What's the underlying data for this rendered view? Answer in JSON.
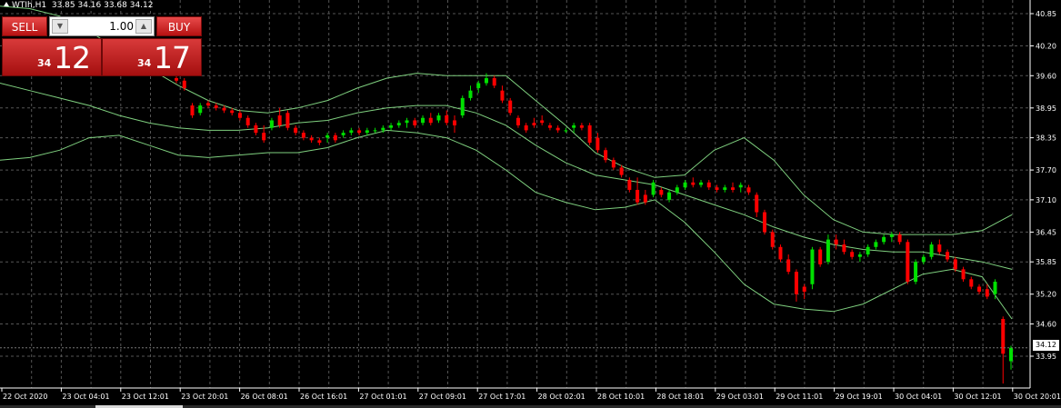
{
  "header": {
    "symbol": "WTIh,H1",
    "ohlc": "33.85 34.16 33.68 34.12"
  },
  "trade_panel": {
    "sell_label": "SELL",
    "buy_label": "BUY",
    "volume": "1.00",
    "sell_price_prefix": "34",
    "sell_price_big": "12",
    "buy_price_prefix": "34",
    "buy_price_big": "17"
  },
  "current_price_label": "34.12",
  "colors": {
    "background": "#000000",
    "grid": "#555555",
    "bull_candle": "#00e000",
    "bear_candle": "#ff0000",
    "bands": "#7fd07f",
    "axis_text": "#ffffff"
  },
  "chart_data": {
    "type": "candlestick",
    "title": "WTIh,H1",
    "price_axis_ticks": [
      "40.85",
      "40.20",
      "39.60",
      "38.95",
      "38.35",
      "37.70",
      "37.10",
      "36.45",
      "35.85",
      "35.20",
      "34.60",
      "33.95"
    ],
    "time_axis_ticks": [
      "22 Oct 2020",
      "23 Oct 04:01",
      "23 Oct 12:01",
      "23 Oct 20:01",
      "26 Oct 08:01",
      "26 Oct 16:01",
      "27 Oct 01:01",
      "27 Oct 09:01",
      "27 Oct 17:01",
      "28 Oct 02:01",
      "28 Oct 10:01",
      "28 Oct 18:01",
      "29 Oct 03:01",
      "29 Oct 11:01",
      "29 Oct 19:01",
      "30 Oct 04:01",
      "30 Oct 12:01",
      "30 Oct 20:01"
    ],
    "ylim": [
      33.45,
      41.0
    ],
    "last_close": 34.12,
    "grid": true,
    "candles": [
      [
        39.55,
        39.6,
        39.45,
        39.5
      ],
      [
        39.5,
        39.55,
        39.3,
        39.35
      ],
      [
        39.0,
        39.05,
        38.75,
        38.8
      ],
      [
        38.85,
        39.05,
        38.8,
        39.0
      ],
      [
        39.05,
        39.1,
        38.95,
        39.0
      ],
      [
        39.0,
        39.05,
        38.9,
        38.95
      ],
      [
        38.95,
        39.0,
        38.85,
        38.9
      ],
      [
        38.9,
        38.95,
        38.8,
        38.85
      ],
      [
        38.85,
        38.9,
        38.7,
        38.75
      ],
      [
        38.75,
        38.8,
        38.55,
        38.6
      ],
      [
        38.6,
        38.65,
        38.4,
        38.45
      ],
      [
        38.45,
        38.6,
        38.25,
        38.3
      ],
      [
        38.55,
        38.75,
        38.5,
        38.7
      ],
      [
        38.8,
        38.95,
        38.55,
        38.6
      ],
      [
        38.85,
        38.9,
        38.5,
        38.55
      ],
      [
        38.55,
        38.6,
        38.4,
        38.45
      ],
      [
        38.45,
        38.5,
        38.3,
        38.35
      ],
      [
        38.35,
        38.4,
        38.25,
        38.3
      ],
      [
        38.3,
        38.35,
        38.2,
        38.25
      ],
      [
        38.35,
        38.45,
        38.25,
        38.4
      ],
      [
        38.4,
        38.45,
        38.25,
        38.3
      ],
      [
        38.4,
        38.5,
        38.35,
        38.45
      ],
      [
        38.45,
        38.55,
        38.4,
        38.5
      ],
      [
        38.5,
        38.55,
        38.4,
        38.45
      ],
      [
        38.45,
        38.55,
        38.4,
        38.5
      ],
      [
        38.5,
        38.55,
        38.45,
        38.5
      ],
      [
        38.5,
        38.6,
        38.45,
        38.55
      ],
      [
        38.55,
        38.65,
        38.5,
        38.6
      ],
      [
        38.6,
        38.7,
        38.55,
        38.65
      ],
      [
        38.65,
        38.75,
        38.55,
        38.7
      ],
      [
        38.7,
        38.75,
        38.55,
        38.6
      ],
      [
        38.65,
        38.8,
        38.6,
        38.75
      ],
      [
        38.75,
        38.85,
        38.6,
        38.65
      ],
      [
        38.7,
        38.85,
        38.65,
        38.8
      ],
      [
        38.8,
        38.9,
        38.6,
        38.65
      ],
      [
        38.7,
        38.8,
        38.45,
        38.6
      ],
      [
        38.8,
        39.2,
        38.75,
        39.15
      ],
      [
        39.15,
        39.4,
        39.1,
        39.3
      ],
      [
        39.35,
        39.5,
        39.25,
        39.45
      ],
      [
        39.45,
        39.65,
        39.4,
        39.55
      ],
      [
        39.55,
        39.6,
        39.35,
        39.4
      ],
      [
        39.3,
        39.4,
        39.05,
        39.1
      ],
      [
        39.1,
        39.15,
        38.8,
        38.85
      ],
      [
        38.75,
        38.8,
        38.55,
        38.6
      ],
      [
        38.6,
        38.65,
        38.45,
        38.5
      ],
      [
        38.65,
        38.75,
        38.55,
        38.6
      ],
      [
        38.7,
        38.8,
        38.6,
        38.65
      ],
      [
        38.6,
        38.65,
        38.5,
        38.55
      ],
      [
        38.55,
        38.6,
        38.45,
        38.5
      ],
      [
        38.5,
        38.55,
        38.45,
        38.5
      ],
      [
        38.55,
        38.65,
        38.45,
        38.6
      ],
      [
        38.6,
        38.65,
        38.5,
        38.55
      ],
      [
        38.6,
        38.65,
        38.2,
        38.25
      ],
      [
        38.35,
        38.45,
        38.05,
        38.1
      ],
      [
        38.1,
        38.15,
        37.85,
        37.9
      ],
      [
        37.9,
        37.95,
        37.7,
        37.75
      ],
      [
        37.75,
        37.8,
        37.55,
        37.6
      ],
      [
        37.5,
        37.55,
        37.25,
        37.3
      ],
      [
        37.3,
        37.55,
        37.0,
        37.05
      ],
      [
        37.2,
        37.3,
        37.0,
        37.05
      ],
      [
        37.2,
        37.5,
        37.15,
        37.45
      ],
      [
        37.3,
        37.35,
        37.15,
        37.2
      ],
      [
        37.1,
        37.3,
        37.05,
        37.25
      ],
      [
        37.25,
        37.4,
        37.2,
        37.35
      ],
      [
        37.35,
        37.5,
        37.3,
        37.45
      ],
      [
        37.45,
        37.55,
        37.35,
        37.4
      ],
      [
        37.4,
        37.5,
        37.35,
        37.45
      ],
      [
        37.45,
        37.5,
        37.3,
        37.35
      ],
      [
        37.35,
        37.4,
        37.25,
        37.3
      ],
      [
        37.3,
        37.4,
        37.25,
        37.35
      ],
      [
        37.35,
        37.45,
        37.25,
        37.3
      ],
      [
        37.35,
        37.45,
        37.25,
        37.4
      ],
      [
        37.35,
        37.4,
        37.2,
        37.25
      ],
      [
        37.2,
        37.25,
        36.75,
        36.85
      ],
      [
        36.85,
        36.9,
        36.4,
        36.45
      ],
      [
        36.45,
        36.5,
        36.1,
        36.15
      ],
      [
        36.15,
        36.2,
        35.85,
        35.9
      ],
      [
        35.9,
        36.0,
        35.6,
        35.65
      ],
      [
        35.65,
        35.7,
        35.05,
        35.2
      ],
      [
        35.35,
        35.4,
        35.1,
        35.25
      ],
      [
        35.4,
        36.15,
        35.3,
        36.1
      ],
      [
        36.1,
        36.15,
        35.75,
        35.8
      ],
      [
        35.85,
        36.4,
        35.8,
        36.3
      ],
      [
        36.3,
        36.4,
        36.1,
        36.2
      ],
      [
        36.2,
        36.3,
        36.0,
        36.05
      ],
      [
        36.05,
        36.1,
        35.9,
        35.95
      ],
      [
        35.95,
        36.05,
        35.85,
        36.0
      ],
      [
        36.0,
        36.2,
        35.95,
        36.15
      ],
      [
        36.15,
        36.3,
        36.1,
        36.25
      ],
      [
        36.25,
        36.4,
        36.2,
        36.35
      ],
      [
        36.35,
        36.45,
        36.25,
        36.4
      ],
      [
        36.4,
        36.45,
        36.2,
        36.25
      ],
      [
        36.25,
        36.3,
        35.4,
        35.45
      ],
      [
        35.45,
        35.9,
        35.4,
        35.85
      ],
      [
        35.85,
        36.0,
        35.8,
        35.95
      ],
      [
        35.95,
        36.25,
        35.9,
        36.2
      ],
      [
        36.2,
        36.3,
        36.0,
        36.05
      ],
      [
        36.05,
        36.1,
        35.85,
        35.9
      ],
      [
        35.9,
        35.95,
        35.65,
        35.7
      ],
      [
        35.7,
        35.75,
        35.45,
        35.5
      ],
      [
        35.5,
        35.55,
        35.3,
        35.35
      ],
      [
        35.35,
        35.4,
        35.2,
        35.25
      ],
      [
        35.3,
        35.4,
        35.1,
        35.15
      ],
      [
        35.2,
        35.5,
        35.1,
        35.45
      ],
      [
        34.7,
        34.75,
        33.4,
        34.0
      ],
      [
        33.85,
        34.16,
        33.68,
        34.12
      ]
    ],
    "band_upper": [
      41.0,
      40.95,
      40.8,
      40.5,
      40.1,
      39.75,
      39.4,
      39.1,
      38.9,
      38.85,
      38.95,
      39.1,
      39.35,
      39.55,
      39.65,
      39.6,
      39.6,
      39.6,
      39.1,
      38.6,
      38.05,
      37.75,
      37.55,
      37.6,
      38.1,
      38.35,
      37.9,
      37.2,
      36.7,
      36.45,
      36.4,
      36.4,
      36.4,
      36.48,
      36.8
    ],
    "band_middle": [
      39.45,
      39.3,
      39.15,
      39.0,
      38.8,
      38.65,
      38.55,
      38.5,
      38.5,
      38.55,
      38.65,
      38.7,
      38.85,
      38.95,
      39.0,
      39.0,
      38.85,
      38.6,
      38.2,
      37.85,
      37.6,
      37.5,
      37.4,
      37.2,
      37.0,
      36.8,
      36.55,
      36.35,
      36.2,
      36.1,
      36.05,
      36.05,
      35.95,
      35.85,
      35.7
    ],
    "band_lower": [
      37.9,
      37.95,
      38.1,
      38.35,
      38.4,
      38.2,
      38.0,
      37.95,
      38.0,
      38.05,
      38.05,
      38.15,
      38.35,
      38.5,
      38.45,
      38.35,
      38.1,
      37.7,
      37.25,
      37.05,
      36.9,
      36.95,
      37.1,
      36.65,
      36.05,
      35.4,
      35.0,
      34.9,
      34.85,
      35.0,
      35.3,
      35.6,
      35.7,
      35.55,
      34.7
    ],
    "band_x_start": 0,
    "band_x_end": 1113
  }
}
